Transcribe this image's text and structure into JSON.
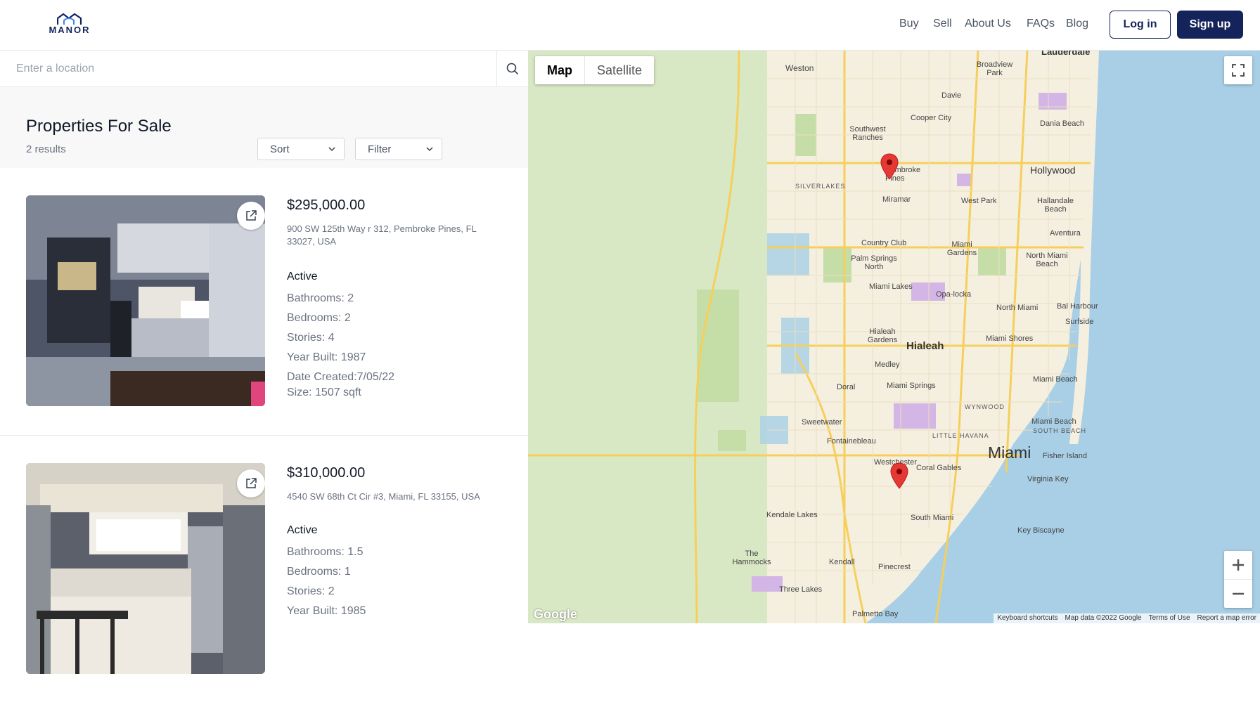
{
  "header": {
    "logo_text": "MANOR",
    "nav": [
      "Buy",
      "Sell",
      "About Us",
      "FAQs",
      "Blog"
    ],
    "login_label": "Log in",
    "signup_label": "Sign up"
  },
  "search": {
    "placeholder": "Enter a location",
    "value": ""
  },
  "listing_header": {
    "title": "Properties For Sale",
    "count": "2 results",
    "sort_label": "Sort",
    "filter_label": "Filter"
  },
  "listings": [
    {
      "price": "$295,000.00",
      "address": "900 SW 125th Way r 312, Pembroke Pines, FL 33027, USA",
      "status": "Active",
      "bathrooms": "Bathrooms: 2",
      "bedrooms": "Bedrooms: 2",
      "stories": "Stories: 4",
      "year_built": "Year Built: 1987",
      "date_created": "Date Created:7/05/22",
      "size": "Size: 1507 sqft"
    },
    {
      "price": "$310,000.00",
      "address": "4540 SW 68th Ct Cir #3, Miami, FL 33155, USA",
      "status": "Active",
      "bathrooms": "Bathrooms: 1.5",
      "bedrooms": "Bedrooms: 1",
      "stories": "Stories: 2",
      "year_built": "Year Built: 1985"
    }
  ],
  "map": {
    "type_controls": [
      "Map",
      "Satellite"
    ],
    "selected_type": "Map",
    "labels": [
      "Lauderdale",
      "Weston",
      "Broadview Park",
      "Davie",
      "Cooper City",
      "Dania Beach",
      "Southwest Ranches",
      "Pembroke Pines",
      "Hollywood",
      "SILVERLAKES",
      "Miramar",
      "West Park",
      "Hallandale Beach",
      "Aventura",
      "Country Club",
      "Miami Gardens",
      "Palm Springs North",
      "North Miami Beach",
      "Miami Lakes",
      "Opa-locka",
      "North Miami",
      "Bal Harbour",
      "Surfside",
      "Hialeah Gardens",
      "Hialeah",
      "Miami Shores",
      "Medley",
      "Miami Beach",
      "Doral",
      "Miami Springs",
      "WYNWOOD",
      "Sweetwater",
      "LITTLE HAVANA",
      "Miami Beach",
      "SOUTH BEACH",
      "Fontainebleau",
      "Miami",
      "Westchester",
      "Fisher Island",
      "Coral Gables",
      "Virginia Key",
      "Kendale Lakes",
      "South Miami",
      "Key Biscayne",
      "The Hammocks",
      "Kendall",
      "Pinecrest",
      "Three Lakes",
      "Palmetto Bay"
    ],
    "footer": [
      "Keyboard shortcuts",
      "Map data ©2022 Google",
      "Terms of Use",
      "Report a map error"
    ],
    "google_mark": "Google",
    "colors": {
      "water": "#a8cfe6",
      "land": "#f5efe0",
      "park": "#cfe3b5",
      "marker": "#e53935"
    }
  }
}
